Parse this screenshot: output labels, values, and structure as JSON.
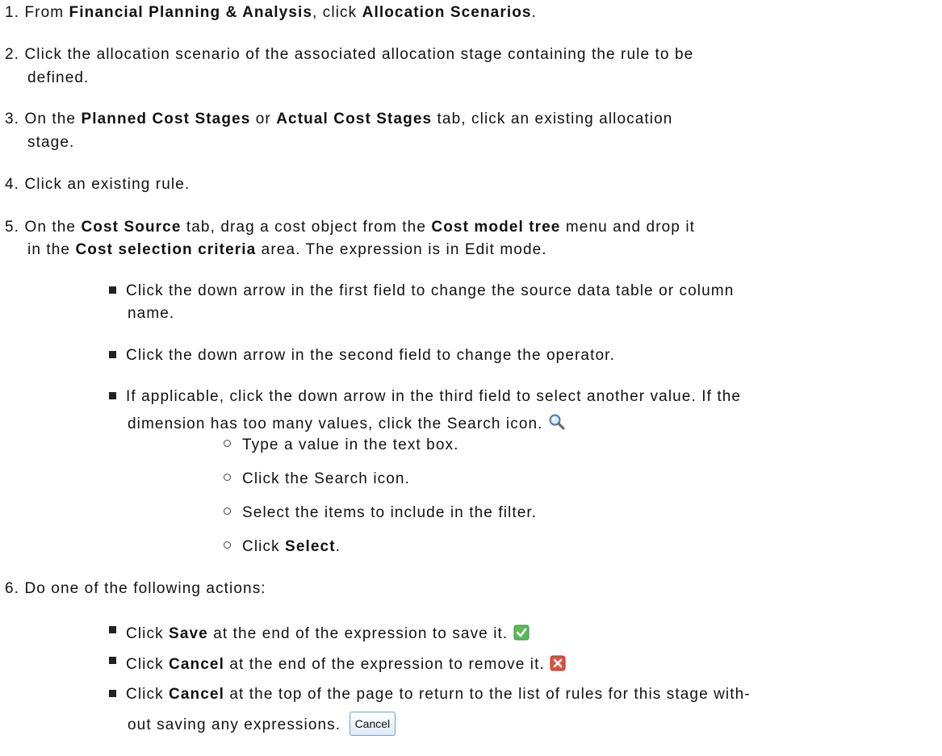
{
  "step1": {
    "num": "1.",
    "pre": "From ",
    "b1": "Financial Planning & Analysis",
    "mid": ", click ",
    "b2": "Allocation Scenarios",
    "post": "."
  },
  "step2": {
    "num": "2.",
    "l1": "Click the allocation scenario of the associated allocation stage containing the rule to be",
    "l2": "defined."
  },
  "step3": {
    "num": "3.",
    "pre": "On the ",
    "b1": "Planned Cost Stages",
    "mid": " or ",
    "b2": "Actual Cost Stages",
    "post": " tab, click an existing allocation",
    "l2": "stage."
  },
  "step4": {
    "num": "4.",
    "text": "Click an existing rule."
  },
  "step5": {
    "num": "5.",
    "pre": "On the ",
    "b1": "Cost Source",
    "mid": " tab, drag a cost object from the ",
    "b2": "Cost model tree",
    "post": " menu and drop it",
    "l2pre": "in the ",
    "l2b": "Cost selection criteria",
    "l2post": " area. The expression is in Edit mode."
  },
  "bullets": {
    "b1l1": "Click the down arrow in the first field to change the source data table or column",
    "b1l2": "name.",
    "b2": "Click the down arrow in the second field to change the operator.",
    "b3l1": "If applicable, click the down arrow in the third field to select another value. If the",
    "b3l2": "dimension has too many values, click the Search icon."
  },
  "sub": {
    "s1": "Type a value in the text box.",
    "s2": "Click the Search icon.",
    "s3": "Select the items to include in the filter.",
    "s4pre": "Click ",
    "s4b": "Select",
    "s4post": "."
  },
  "step6": {
    "num": "6.",
    "text": "Do one of the following actions:"
  },
  "actions": {
    "a1pre": "Click ",
    "a1b": "Save",
    "a1post": " at the end of the expression to save it.",
    "a2pre": "Click ",
    "a2b": "Cancel",
    "a2post": " at the end of the expression to remove it.",
    "a3pre": "Click ",
    "a3b": "Cancel",
    "a3post": " at the top of the page to return to the list of rules for this stage with-",
    "a3l2": "out saving any expressions.",
    "cancel_button": "Cancel"
  },
  "icons": {
    "search": "search-icon",
    "save": "checkmark-icon",
    "remove": "close-icon"
  }
}
